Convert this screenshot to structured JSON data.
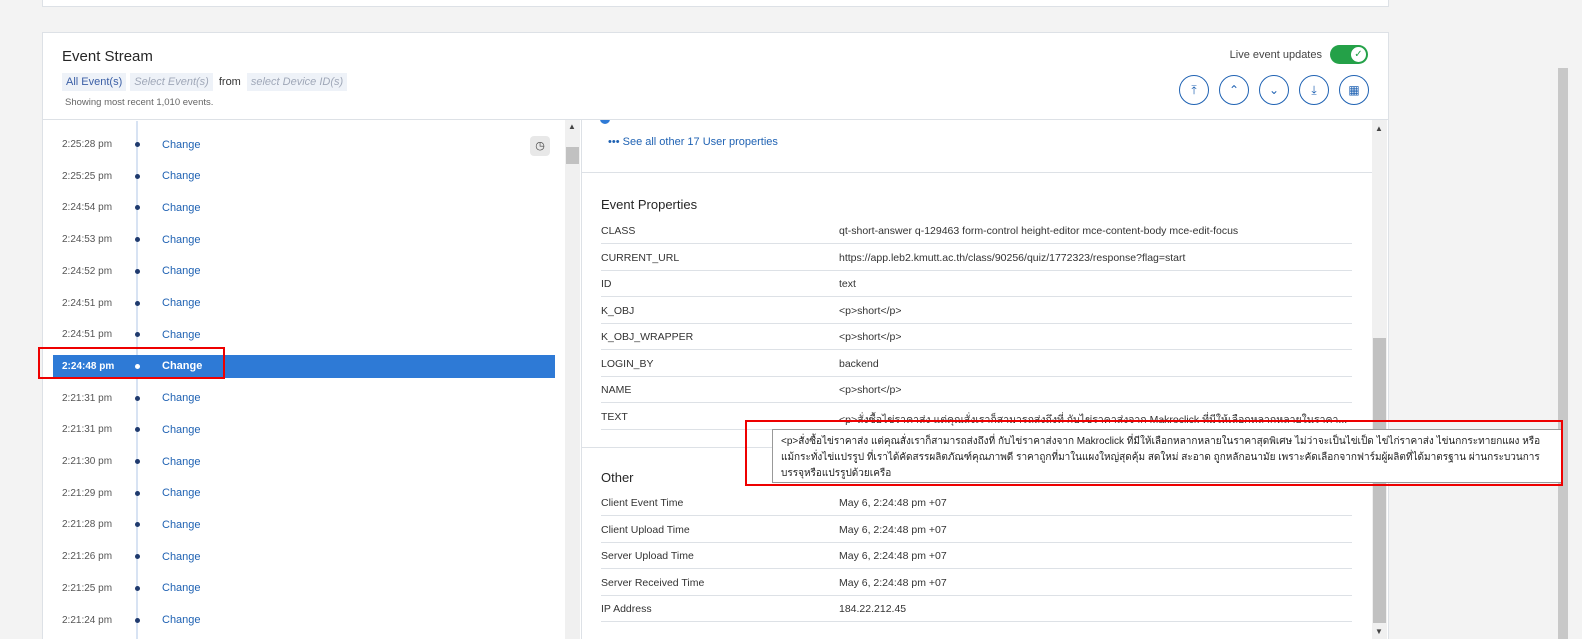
{
  "header": {
    "title": "Event Stream",
    "filter_all": "All Event(s)",
    "filter_select_events": "Select Event(s)",
    "from": "from",
    "filter_device": "select Device ID(s)",
    "showing": "Showing most recent 1,010 events.",
    "live_label": "Live event updates",
    "toggle_check": "✓"
  },
  "nav": {
    "first": "⤒",
    "prev": "⌃",
    "next": "⌄",
    "last": "⤓",
    "calendar": "▦"
  },
  "events": [
    {
      "time": "2:25:28 pm",
      "name": "Change"
    },
    {
      "time": "2:25:25 pm",
      "name": "Change"
    },
    {
      "time": "2:24:54 pm",
      "name": "Change"
    },
    {
      "time": "2:24:53 pm",
      "name": "Change"
    },
    {
      "time": "2:24:52 pm",
      "name": "Change"
    },
    {
      "time": "2:24:51 pm",
      "name": "Change"
    },
    {
      "time": "2:24:51 pm",
      "name": "Change"
    },
    {
      "time": "2:24:48 pm",
      "name": "Change"
    },
    {
      "time": "2:21:31 pm",
      "name": "Change"
    },
    {
      "time": "2:21:31 pm",
      "name": "Change"
    },
    {
      "time": "2:21:30 pm",
      "name": "Change"
    },
    {
      "time": "2:21:29 pm",
      "name": "Change"
    },
    {
      "time": "2:21:28 pm",
      "name": "Change"
    },
    {
      "time": "2:21:26 pm",
      "name": "Change"
    },
    {
      "time": "2:21:25 pm",
      "name": "Change"
    },
    {
      "time": "2:21:24 pm",
      "name": "Change"
    }
  ],
  "selected_index": 7,
  "clock_icon": "◷",
  "see_all": "••• See all other 17 User properties",
  "event_properties": {
    "title": "Event Properties",
    "rows": [
      {
        "k": "CLASS",
        "v": "qt-short-answer q-129463 form-control height-editor mce-content-body mce-edit-focus"
      },
      {
        "k": "CURRENT_URL",
        "v": "https://app.leb2.kmutt.ac.th/class/90256/quiz/1772323/response?flag=start"
      },
      {
        "k": "ID",
        "v": "text"
      },
      {
        "k": "K_OBJ",
        "v": "<p>short</p>"
      },
      {
        "k": "K_OBJ_WRAPPER",
        "v": "<p>short</p>"
      },
      {
        "k": "LOGIN_BY",
        "v": "backend"
      },
      {
        "k": "NAME",
        "v": "<p>short</p>"
      },
      {
        "k": "TEXT",
        "v": "<p>สั่งซื้อไข่ราคาส่ง แต่คุณสั่งเราก็สามารถส่งถึงที่ กับไข่ราคาส่งจาก Makroclick ที่มีให้เลือกหลากหลายในราคา..."
      }
    ]
  },
  "other": {
    "title": "Other",
    "rows": [
      {
        "k": "Client Event Time",
        "v": "May 6, 2:24:48 pm +07"
      },
      {
        "k": "Client Upload Time",
        "v": "May 6, 2:24:48 pm +07"
      },
      {
        "k": "Server Upload Time",
        "v": "May 6, 2:24:48 pm +07"
      },
      {
        "k": "Server Received Time",
        "v": "May 6, 2:24:48 pm +07"
      },
      {
        "k": "IP Address",
        "v": "184.22.212.45"
      }
    ]
  },
  "tooltip": "<p>สั่งซื้อไข่ราคาส่ง แต่คุณสั่งเราก็สามารถส่งถึงที่ กับไข่ราคาส่งจาก Makroclick ที่มีให้เลือกหลากหลายในราคาสุดพิเศษ ไม่ว่าจะเป็นไข่เป็ด ไข่ไก่ราคาส่ง ไข่นกกระทายกแผง หรือแม้กระทั่งไข่แปรรูป ที่เราได้คัดสรรผลิตภัณฑ์คุณภาพดี ราคาถูกที่มาในแผงใหญ่สุดคุ้ม สดใหม่ สะอาด ถูกหลักอนามัย เพราะคัดเลือกจากฟาร์มผู้ผลิตที่ได้มาตรฐาน ผ่านกระบวนการบรรจุหรือแปรรูปด้วยเครือ"
}
